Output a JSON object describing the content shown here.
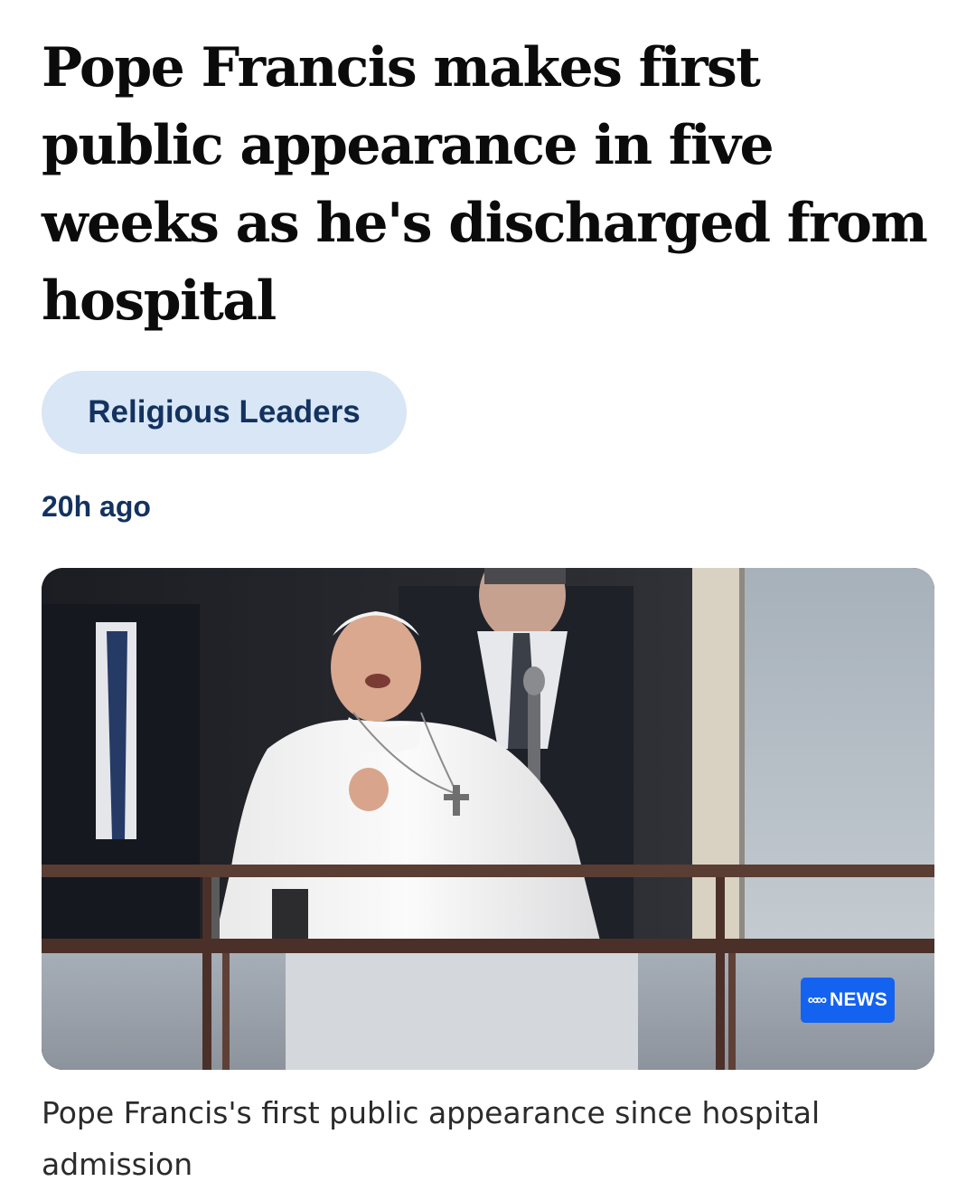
{
  "article": {
    "headline": "Pope Francis makes first public appearance in five weeks as he's discharged from hospital",
    "topic": "Religious Leaders",
    "timestamp": "20h ago",
    "image": {
      "badge": {
        "logo_icon": "abc-logo-icon",
        "label": "NEWS",
        "color": "#1463f0"
      }
    },
    "caption": "Pope Francis's first public appearance since hospital admission"
  },
  "colors": {
    "pill_background": "#d8e6f6",
    "link_text": "#13325f",
    "headline_text": "#0b0b0b"
  }
}
